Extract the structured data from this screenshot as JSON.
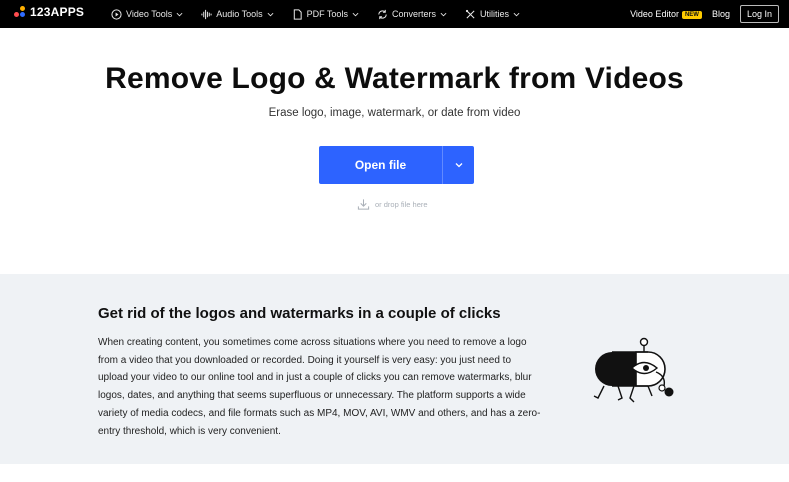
{
  "brand": {
    "name": "123APPS"
  },
  "nav": {
    "items": [
      {
        "label": "Video Tools",
        "icon": "play-circle-icon"
      },
      {
        "label": "Audio Tools",
        "icon": "waveform-icon"
      },
      {
        "label": "PDF Tools",
        "icon": "document-icon"
      },
      {
        "label": "Converters",
        "icon": "convert-icon"
      },
      {
        "label": "Utilities",
        "icon": "tools-icon"
      }
    ],
    "video_editor_label": "Video Editor",
    "new_badge": "NEW",
    "blog_label": "Blog",
    "login_label": "Log In"
  },
  "hero": {
    "title": "Remove Logo & Watermark from Videos",
    "subtitle": "Erase logo, image, watermark, or date from video",
    "open_file_label": "Open file",
    "drop_hint": "or drop file here"
  },
  "info": {
    "title": "Get rid of the logos and watermarks in a couple of clicks",
    "lines": [
      "When creating content, you sometimes come across situations where you need to remove a logo",
      "from a video that you downloaded or recorded. Doing it yourself is very easy: you just need to",
      "upload your video to our online tool and in just a couple of clicks you can remove watermarks, blur",
      "logos, dates, and anything that seems superfluous or unnecessary. The platform supports a wide",
      "variety of media codecs, and file formats such as MP4, MOV, AVI, WMV and others, and has a zero-",
      "entry threshold, which is very convenient."
    ]
  },
  "colors": {
    "accent": "#2d63ff",
    "nav_bg": "#000000",
    "section_bg": "#eff2f5",
    "badge": "#ffcc00"
  }
}
